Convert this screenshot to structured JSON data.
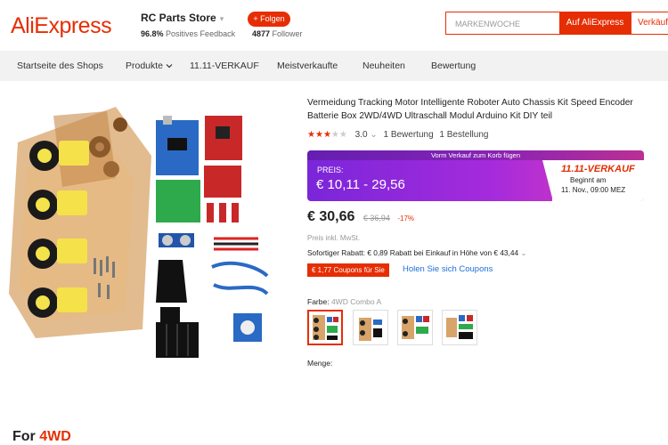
{
  "header": {
    "logo": "AliExpress",
    "store_name": "RC Parts Store",
    "store_chevron": "▾",
    "feedback_value": "96.8%",
    "feedback_label": "Positives Feedback",
    "follow_label": "+ Folgen",
    "follower_count": "4877",
    "follower_label": "Follower",
    "search_placeholder": "MARKENWOCHE",
    "search_button_aliexpress": "Auf AliExpress",
    "search_button_store": "Verkäufer"
  },
  "nav": {
    "items": [
      "Startseite des Shops",
      "Produkte",
      "11.11-VERKAUF",
      "Meistverkaufte",
      "Neuheiten",
      "Bewertung"
    ]
  },
  "gallery": {
    "label_prefix": "For",
    "label_highlight": "4WD"
  },
  "product": {
    "title": "Vermeidung Tracking Motor Intelligente Roboter Auto Chassis Kit Speed Encoder Batterie Box 2WD/4WD Ultraschall Modul Arduino Kit DIY teil",
    "rating_stars": 3,
    "rating_value": "3.0",
    "rating_chevron": "⌄",
    "review_text": "1 Bewertung",
    "order_text": "1 Bestellung",
    "promo_top": "Vorm Verkauf zum Korb fügen",
    "promo_price_label": "PREIS:",
    "promo_price": "€ 10,11 - 29,56",
    "badge_title": "11.11-VERKAUF",
    "badge_line1": "Beginnt am",
    "badge_line2": "11. Nov., 09:00 MEZ",
    "price": "€ 30,66",
    "old_price": "€ 36,94",
    "discount": "-17%",
    "tax_note": "Preis inkl. MwSt.",
    "instant_discount": "Sofortiger Rabatt: € 0,89 Rabatt bei Einkauf in Höhe von € 43,44",
    "instant_chevron": "⌄",
    "coupon_tag": "€ 1,77 Coupons für Sie",
    "coupon_link": "Holen Sie sich Coupons",
    "color_label": "Farbe:",
    "color_value": "4WD Combo A",
    "quantity_label": "Menge:"
  },
  "colors": {
    "accent": "#e62e04",
    "promo_start": "#7a26d9",
    "promo_end": "#e43bb5",
    "link": "#1f6fd9"
  }
}
